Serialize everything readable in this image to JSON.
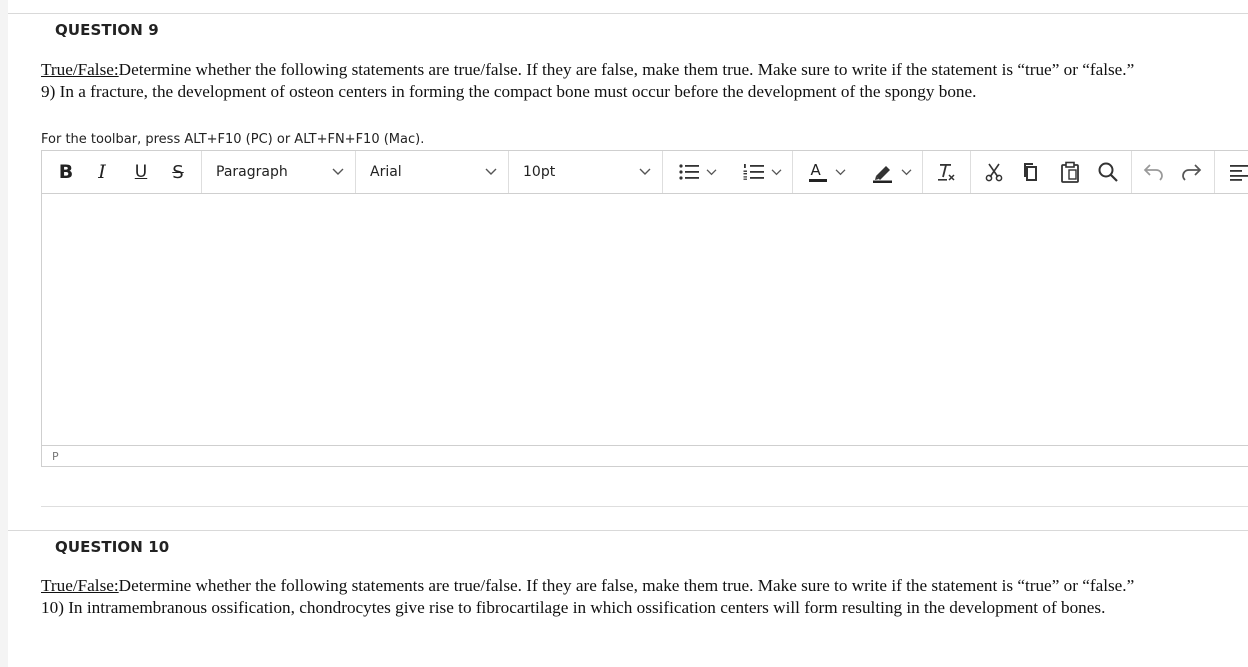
{
  "question9": {
    "title": "QUESTION 9",
    "prefix": "True/False:",
    "instruction": "Determine whether the following statements are true/false. If they are false, make them true. Make sure to write if the statement is “true” or “false.”",
    "statement": "9) In a fracture, the development of osteon centers in forming the compact bone must occur before the development of the spongy bone."
  },
  "editor": {
    "hint": "For the toolbar, press ALT+F10 (PC) or ALT+FN+F10 (Mac).",
    "bold": "B",
    "italic": "I",
    "underline": "U",
    "strikethrough": "S",
    "block_format": "Paragraph",
    "font_family": "Arial",
    "font_size": "10pt",
    "text_color_letter": "A",
    "path": "P",
    "content": ""
  },
  "question10": {
    "title": "QUESTION 10",
    "prefix": "True/False:",
    "instruction": "Determine whether the following statements are true/false. If they are false, make them true. Make sure to write if the statement is “true” or “false.”",
    "statement": "10) In intramembranous ossification, chondrocytes give rise to fibrocartilage in which ossification centers will form resulting in the development of bones."
  },
  "icons": [
    "bullet-list-icon",
    "numbered-list-icon",
    "text-color-icon",
    "highlight-icon",
    "clear-formatting-icon",
    "cut-icon",
    "copy-icon",
    "paste-icon",
    "find-icon",
    "undo-icon",
    "redo-icon",
    "align-icon",
    "chevron-down-icon"
  ]
}
